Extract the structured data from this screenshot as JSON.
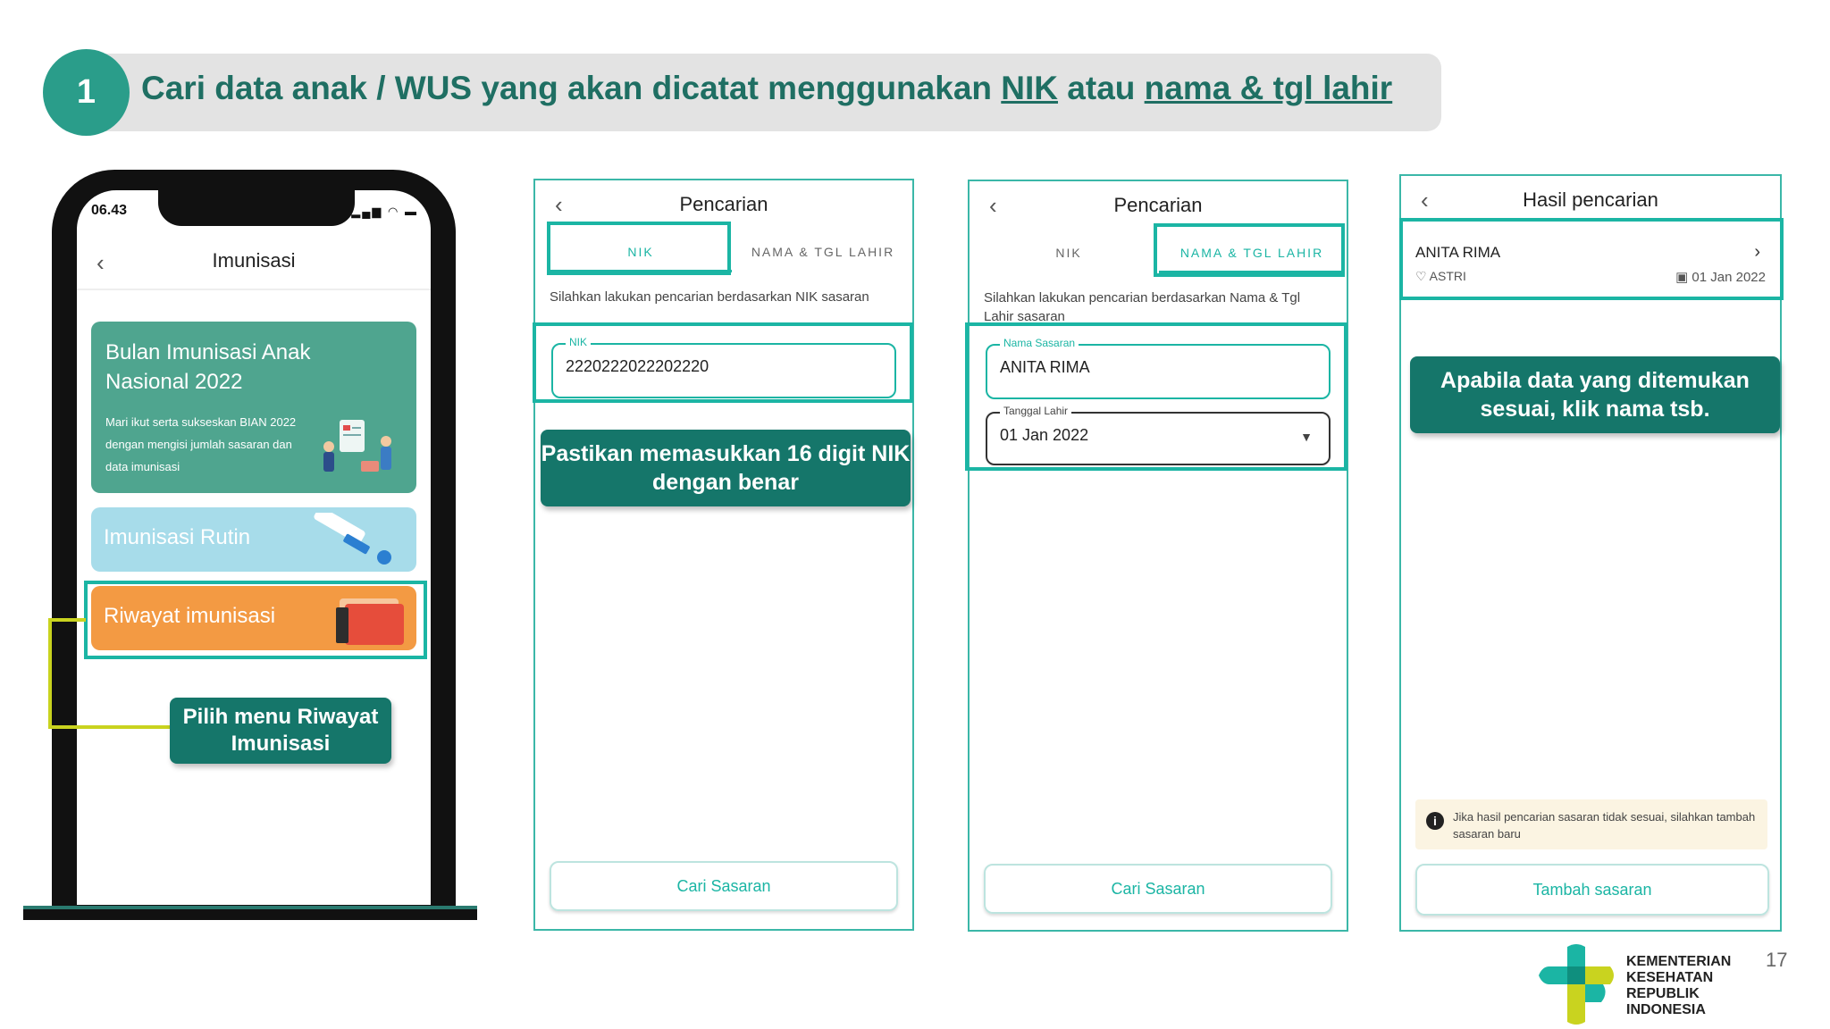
{
  "header": {
    "step_number": "1",
    "title_part1": "Cari data anak / WUS yang akan dicatat menggunakan ",
    "title_nik": "NIK",
    "title_part2": " atau ",
    "title_nama": "nama & tgl lahir"
  },
  "phone": {
    "status_time": "06.43",
    "title": "Imunisasi",
    "card_bian_title": "Bulan Imunisasi Anak Nasional 2022",
    "card_bian_sub": "Mari ikut serta sukseskan BIAN 2022 dengan mengisi jumlah sasaran dan data imunisasi",
    "card_rutin": "Imunisasi Rutin",
    "card_riwayat": "Riwayat imunisasi",
    "callout": "Pilih menu Riwayat Imunisasi"
  },
  "screen_nik": {
    "title": "Pencarian",
    "tab_nik": "NIK",
    "tab_nama": "NAMA & TGL LAHIR",
    "description": "Silahkan lakukan pencarian berdasarkan NIK sasaran",
    "field_label": "NIK",
    "field_value": "2220222022202220",
    "button": "Cari Sasaran",
    "callout": "Pastikan memasukkan 16 digit NIK dengan benar"
  },
  "screen_nama": {
    "title": "Pencarian",
    "tab_nik": "NIK",
    "tab_nama": "NAMA & TGL LAHIR",
    "description": "Silahkan lakukan pencarian berdasarkan Nama & Tgl Lahir sasaran",
    "name_label": "Nama Sasaran",
    "name_value": "ANITA RIMA",
    "dob_label": "Tanggal Lahir",
    "dob_value": "01 Jan 2022",
    "button": "Cari Sasaran"
  },
  "screen_result": {
    "title": "Hasil pencarian",
    "result_name": "ANITA RIMA",
    "result_sub": "ASTRI",
    "result_date": "01 Jan 2022",
    "callout": "Apabila data yang ditemukan sesuai, klik nama tsb.",
    "note": "Jika hasil pencarian sasaran tidak sesuai, silahkan tambah sasaran baru",
    "button": "Tambah sasaran"
  },
  "footer": {
    "logo_text": "KEMENTERIAN KESEHATAN REPUBLIK INDONESIA",
    "page_number": "17"
  },
  "colors": {
    "teal": "#2a9d8a",
    "teal_dark": "#15766a",
    "highlight": "#1bb5a4",
    "connector": "#c9d31f",
    "orange": "#f39a43",
    "light_blue": "#a7dcea"
  }
}
